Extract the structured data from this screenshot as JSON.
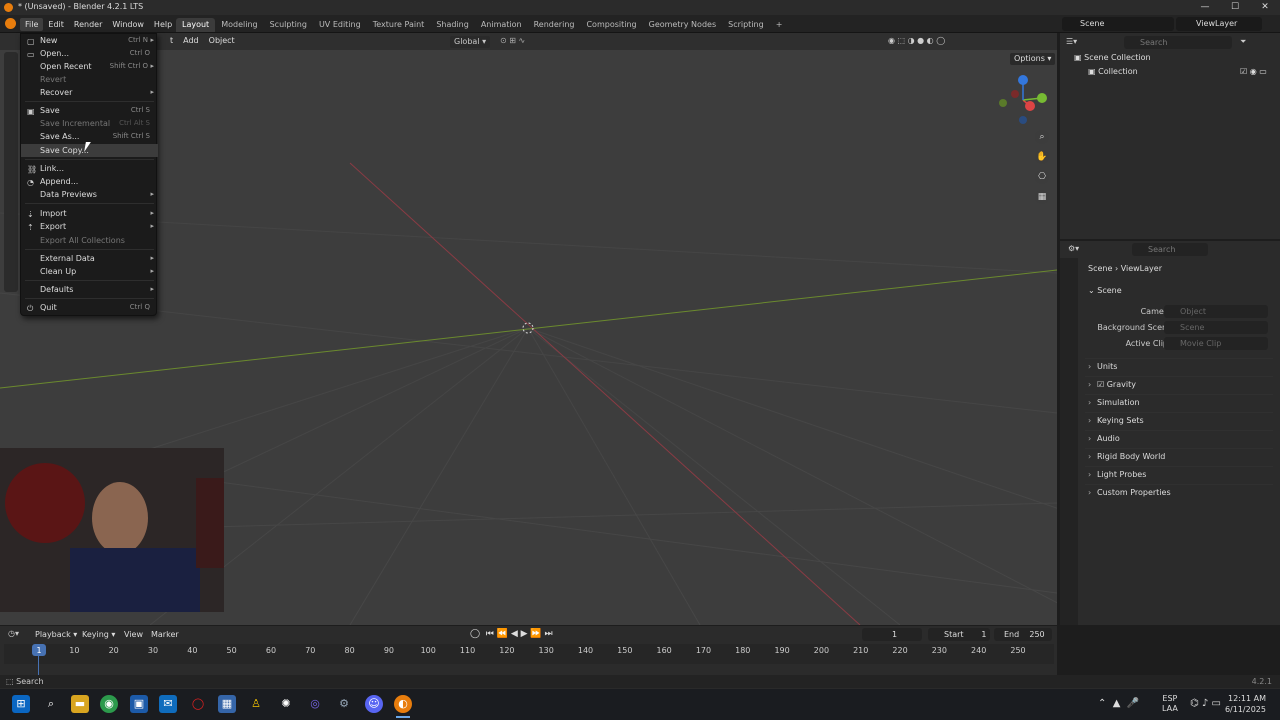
{
  "window": {
    "title": "* (Unsaved) - Blender 4.2.1 LTS",
    "min": "—",
    "max": "☐",
    "close": "✕"
  },
  "menubar": [
    "File",
    "Edit",
    "Render",
    "Window",
    "Help"
  ],
  "workspaces": [
    "Layout",
    "Modeling",
    "Sculpting",
    "UV Editing",
    "Texture Paint",
    "Shading",
    "Animation",
    "Rendering",
    "Compositing",
    "Geometry Nodes",
    "Scripting",
    "+"
  ],
  "scene_selector": "Scene",
  "viewlayer_selector": "ViewLayer",
  "viewport_header": {
    "add": "Add",
    "object": "Object",
    "transform": "Global",
    "object_partial": "t"
  },
  "viewport_options": "Options",
  "file_menu": [
    {
      "label": "New",
      "shortcut": "Ctrl N",
      "arrow": "▸",
      "icon": "▢",
      "disabled": false
    },
    {
      "label": "Open...",
      "shortcut": "Ctrl O",
      "arrow": "",
      "icon": "▭",
      "disabled": false
    },
    {
      "label": "Open Recent",
      "shortcut": "Shift Ctrl O",
      "arrow": "▸",
      "icon": "",
      "disabled": false
    },
    {
      "label": "Revert",
      "shortcut": "",
      "arrow": "",
      "icon": "",
      "disabled": true
    },
    {
      "label": "Recover",
      "shortcut": "",
      "arrow": "▸",
      "icon": "",
      "disabled": false
    },
    {
      "label": "Save",
      "shortcut": "Ctrl S",
      "arrow": "",
      "icon": "▣",
      "disabled": false
    },
    {
      "label": "Save Incremental",
      "shortcut": "Ctrl Alt S",
      "arrow": "",
      "icon": "",
      "disabled": true
    },
    {
      "label": "Save As...",
      "shortcut": "Shift Ctrl S",
      "arrow": "",
      "icon": "",
      "disabled": false
    },
    {
      "label": "Save Copy...",
      "shortcut": "",
      "arrow": "",
      "icon": "",
      "disabled": false
    },
    {
      "label": "Link...",
      "shortcut": "",
      "arrow": "",
      "icon": "⛓",
      "disabled": false
    },
    {
      "label": "Append...",
      "shortcut": "",
      "arrow": "",
      "icon": "◔",
      "disabled": false
    },
    {
      "label": "Data Previews",
      "shortcut": "",
      "arrow": "▸",
      "icon": "",
      "disabled": false
    },
    {
      "label": "Import",
      "shortcut": "",
      "arrow": "▸",
      "icon": "⇣",
      "disabled": false
    },
    {
      "label": "Export",
      "shortcut": "",
      "arrow": "▸",
      "icon": "⇡",
      "disabled": false
    },
    {
      "label": "Export All Collections",
      "shortcut": "",
      "arrow": "",
      "icon": "",
      "disabled": true
    },
    {
      "label": "External Data",
      "shortcut": "",
      "arrow": "▸",
      "icon": "",
      "disabled": false
    },
    {
      "label": "Clean Up",
      "shortcut": "",
      "arrow": "▸",
      "icon": "",
      "disabled": false
    },
    {
      "label": "Defaults",
      "shortcut": "",
      "arrow": "▸",
      "icon": "",
      "disabled": false
    },
    {
      "label": "Quit",
      "shortcut": "Ctrl Q",
      "arrow": "",
      "icon": "⏻",
      "disabled": false
    }
  ],
  "outliner": {
    "search": "Search",
    "scene_collection": "Scene Collection",
    "collection": "Collection"
  },
  "properties": {
    "search": "Search",
    "breadcrumb_scene": "Scene",
    "breadcrumb_sep": "›",
    "breadcrumb_viewlayer": "ViewLayer",
    "section": "Scene",
    "camera_label": "Camera",
    "camera_placeholder": "Object",
    "bg_label": "Background Scene",
    "bg_placeholder": "Scene",
    "clip_label": "Active Clip",
    "clip_placeholder": "Movie Clip",
    "panels": [
      "Units",
      "Gravity",
      "Simulation",
      "Keying Sets",
      "Audio",
      "Rigid Body World",
      "Light Probes",
      "Custom Properties"
    ]
  },
  "timeline": {
    "playback": "Playback",
    "keying": "Keying",
    "view": "View",
    "marker": "Marker",
    "current_frame": "1",
    "start_label": "Start",
    "start": "1",
    "end_label": "End",
    "end": "250",
    "ticks": [
      "1",
      "10",
      "20",
      "30",
      "40",
      "50",
      "60",
      "70",
      "80",
      "90",
      "100",
      "110",
      "120",
      "130",
      "140",
      "150",
      "160",
      "170",
      "180",
      "190",
      "200",
      "210",
      "220",
      "230",
      "240",
      "250"
    ]
  },
  "status": {
    "search": "Search",
    "version": "4.2.1"
  },
  "taskbar": {
    "lang1": "ESP",
    "lang2": "LAA",
    "time": "12:11 AM",
    "date": "6/11/2025"
  },
  "colors": {
    "accent": "#e87d0d",
    "x_axis": "#8a3b44",
    "y_axis": "#6b8a2e",
    "highlight": "#3c3c3c"
  }
}
